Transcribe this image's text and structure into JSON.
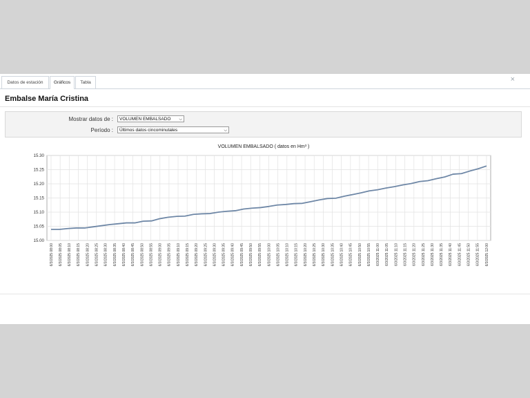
{
  "tabs": [
    {
      "label": "Datos de estación"
    },
    {
      "label": "Gráficos"
    },
    {
      "label": "Tabla"
    }
  ],
  "close_label": "×",
  "page_title": "Embalse María Cristina",
  "form": {
    "label_data": "Mostrar datos de :",
    "select_data_value": "VOLUMEN EMBALSADO",
    "label_period": "Período :",
    "select_period_value": "Últimos datos cincominutales"
  },
  "chart_data": {
    "type": "line",
    "title": "VOLUMEN EMBALSADO ( datos en Hm³ )",
    "xlabel": "",
    "ylabel": "",
    "ylim": [
      15.0,
      15.3
    ],
    "y_ticks": [
      "15.30",
      "15.25",
      "15.20",
      "15.15",
      "15.10",
      "15.05",
      "15.00"
    ],
    "grid": true,
    "categories": [
      "6/3/2025 08:00",
      "6/3/2025 08:05",
      "6/3/2025 08:10",
      "6/3/2025 08:15",
      "6/3/2025 08:20",
      "6/3/2025 08:25",
      "6/3/2025 08:30",
      "6/3/2025 08:35",
      "6/3/2025 08:40",
      "6/3/2025 08:45",
      "6/3/2025 08:50",
      "6/3/2025 08:55",
      "6/3/2025 09:00",
      "6/3/2025 09:05",
      "6/3/2025 09:10",
      "6/3/2025 09:15",
      "6/3/2025 09:20",
      "6/3/2025 09:25",
      "6/3/2025 09:30",
      "6/3/2025 09:35",
      "6/3/2025 09:40",
      "6/3/2025 09:45",
      "6/3/2025 09:50",
      "6/3/2025 09:55",
      "6/3/2025 10:00",
      "6/3/2025 10:05",
      "6/3/2025 10:10",
      "6/3/2025 10:15",
      "6/3/2025 10:20",
      "6/3/2025 10:25",
      "6/3/2025 10:30",
      "6/3/2025 10:35",
      "6/3/2025 10:40",
      "6/3/2025 10:45",
      "6/3/2025 10:50",
      "6/3/2025 10:55",
      "6/3/2025 11:00",
      "6/3/2025 11:05",
      "6/3/2025 11:10",
      "6/3/2025 11:15",
      "6/3/2025 11:20",
      "6/3/2025 11:25",
      "6/3/2025 11:30",
      "6/3/2025 11:35",
      "6/3/2025 11:40",
      "6/3/2025 11:45",
      "6/3/2025 11:50",
      "6/3/2025 11:55",
      "6/3/2025 12:00"
    ],
    "series": [
      {
        "values": [
          15.039,
          15.039,
          15.042,
          15.044,
          15.044,
          15.048,
          15.052,
          15.056,
          15.059,
          15.062,
          15.062,
          15.068,
          15.069,
          15.077,
          15.082,
          15.085,
          15.086,
          15.092,
          15.094,
          15.095,
          15.1,
          15.103,
          15.105,
          15.111,
          15.114,
          15.116,
          15.12,
          15.125,
          15.127,
          15.13,
          15.131,
          15.137,
          15.143,
          15.148,
          15.149,
          15.156,
          15.162,
          15.168,
          15.175,
          15.179,
          15.185,
          15.19,
          15.196,
          15.201,
          15.208,
          15.211,
          15.218,
          15.224,
          15.234,
          15.236,
          15.245,
          15.253,
          15.263
        ]
      }
    ],
    "line_color": "#6e87a6"
  }
}
